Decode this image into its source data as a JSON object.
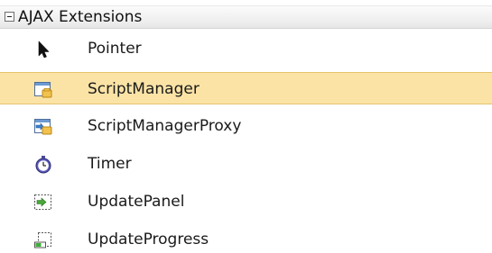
{
  "toolbox": {
    "group": {
      "title": "AJAX Extensions",
      "expanded": true,
      "icon": "collapse-minus-icon"
    },
    "items": [
      {
        "label": "Pointer",
        "icon": "pointer-arrow-icon",
        "selected": false
      },
      {
        "label": "ScriptManager",
        "icon": "script-manager-icon",
        "selected": true
      },
      {
        "label": "ScriptManagerProxy",
        "icon": "script-manager-proxy-icon",
        "selected": false
      },
      {
        "label": "Timer",
        "icon": "stopwatch-icon",
        "selected": false
      },
      {
        "label": "UpdatePanel",
        "icon": "update-panel-icon",
        "selected": false
      },
      {
        "label": "UpdateProgress",
        "icon": "update-progress-icon",
        "selected": false
      }
    ],
    "colors": {
      "selection_fill": "#fbe3a6",
      "selection_border": "#e7c26b",
      "header_background": "#f0f0f0"
    }
  }
}
